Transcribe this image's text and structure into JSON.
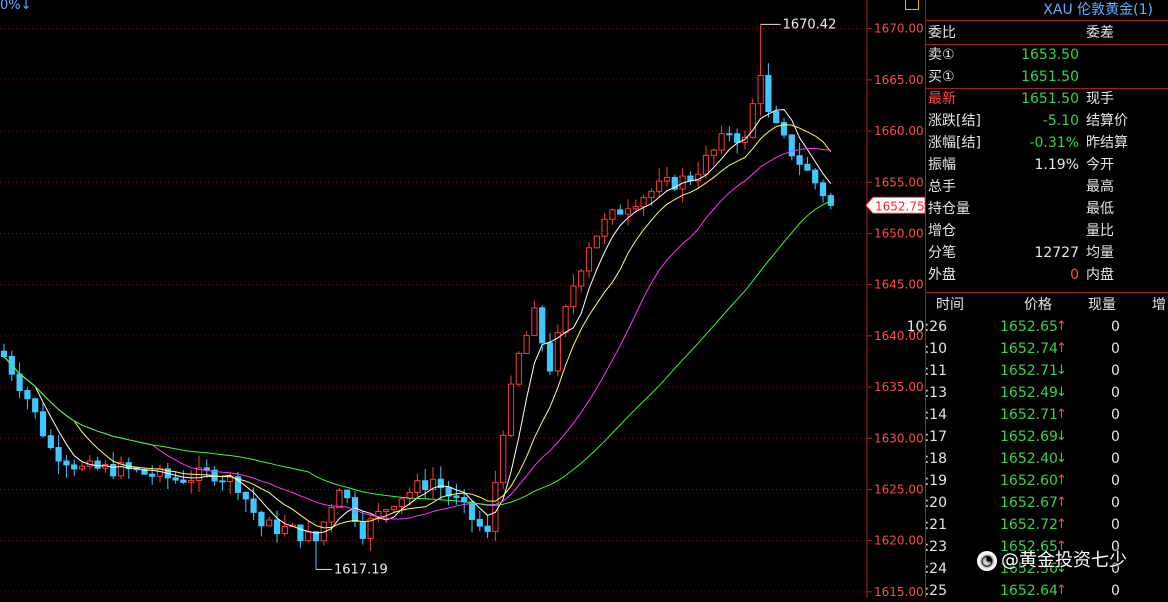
{
  "indicator_text": "0%↓",
  "panel": {
    "title": "XAU 伦敦黄金(1)",
    "quote_rows": [
      {
        "label": "委比",
        "value": "",
        "label2": "委差",
        "value_color": "red"
      },
      {
        "label": "卖①",
        "value": "1653.50",
        "label2": "",
        "value_color": "green"
      },
      {
        "label": "买①",
        "value": "1651.50",
        "label2": "",
        "value_color": "green"
      },
      {
        "label": "最新",
        "value": "1651.50",
        "label2": "现手",
        "value_color": "green"
      },
      {
        "label": "涨跌[结]",
        "value": "-5.10",
        "label2": "结算价",
        "value_color": "green"
      },
      {
        "label": "涨幅[结]",
        "value": "-0.31%",
        "label2": "昨结算",
        "value_color": "green"
      },
      {
        "label": "振幅",
        "value": "1.19%",
        "label2": "今开",
        "value_color": "white"
      },
      {
        "label": "总手",
        "value": "",
        "label2": "最高",
        "value_color": "white"
      },
      {
        "label": "持仓量",
        "value": "",
        "label2": "最低",
        "value_color": "white"
      },
      {
        "label": "增仓",
        "value": "",
        "label2": "量比",
        "value_color": "white"
      },
      {
        "label": "分笔",
        "value": "12727",
        "label2": "均量",
        "value_color": "white"
      },
      {
        "label": "外盘",
        "value": "0",
        "label2": "内盘",
        "value_color": "red"
      }
    ],
    "tick_headers": {
      "time": "时间",
      "price": "价格",
      "volume": "现量",
      "increase": "增"
    },
    "ticks": [
      {
        "time": "10:26",
        "price": "1652.65",
        "arrow": "↑",
        "dir": "up",
        "volume": "0"
      },
      {
        "time": ":10",
        "price": "1652.74",
        "arrow": "↑",
        "dir": "up",
        "volume": "0"
      },
      {
        "time": ":11",
        "price": "1652.71",
        "arrow": "↓",
        "dir": "down",
        "volume": "0"
      },
      {
        "time": ":13",
        "price": "1652.49",
        "arrow": "↓",
        "dir": "down",
        "volume": "0"
      },
      {
        "time": ":14",
        "price": "1652.71",
        "arrow": "↑",
        "dir": "up",
        "volume": "0"
      },
      {
        "time": ":17",
        "price": "1652.69",
        "arrow": "↓",
        "dir": "down",
        "volume": "0"
      },
      {
        "time": ":18",
        "price": "1652.40",
        "arrow": "↓",
        "dir": "down",
        "volume": "0"
      },
      {
        "time": ":19",
        "price": "1652.60",
        "arrow": "↑",
        "dir": "up",
        "volume": "0"
      },
      {
        "time": ":20",
        "price": "1652.67",
        "arrow": "↑",
        "dir": "up",
        "volume": "0"
      },
      {
        "time": ":21",
        "price": "1652.72",
        "arrow": "↑",
        "dir": "up",
        "volume": "0"
      },
      {
        "time": ":23",
        "price": "1652.65",
        "arrow": "↑",
        "dir": "up",
        "volume": "0"
      },
      {
        "time": ":24",
        "price": "1652.56",
        "arrow": "↓",
        "dir": "down",
        "volume": "0"
      },
      {
        "time": ":25",
        "price": "1652.64",
        "arrow": "↑",
        "dir": "up",
        "volume": "0"
      }
    ]
  },
  "watermark": {
    "icon": "weibo-icon",
    "text": "@黄金投资七少"
  },
  "colors": {
    "up": "#ff3b3b",
    "down": "#3fc8ff",
    "grid": "#7a1a1a",
    "axis_text": "#ff4a4a",
    "ma_short": "#ffffff",
    "ma_mid": "#ffff55",
    "ma_long": "#ff33ff",
    "ma_longest": "#33ff33"
  },
  "chart_data": {
    "type": "candlestick",
    "y_ticks": [
      "1670.00",
      "1665.00",
      "1660.00",
      "1655.00",
      "1650.00",
      "1645.00",
      "1640.00",
      "1635.00",
      "1630.00",
      "1625.00",
      "1620.00",
      "1615.00"
    ],
    "ylim": [
      1614.4,
      1672.8
    ],
    "current_price_label": "1652.75",
    "current_price": 1652.75,
    "high_annotation": {
      "text": "1670.42",
      "value": 1670.42
    },
    "low_annotation": {
      "text": "1617.19",
      "value": 1617.19
    },
    "key_points": [
      [
        0,
        1638.0
      ],
      [
        3,
        1634.0
      ],
      [
        6,
        1629.0
      ],
      [
        10,
        1627.0
      ],
      [
        15,
        1627.0
      ],
      [
        22,
        1626.0
      ],
      [
        27,
        1626.6
      ],
      [
        30,
        1625.5
      ],
      [
        33,
        1621.5
      ],
      [
        37,
        1621.0
      ],
      [
        40,
        1620.0
      ],
      [
        43,
        1625.5
      ],
      [
        46,
        1621.0
      ],
      [
        50,
        1624.0
      ],
      [
        55,
        1626.0
      ],
      [
        59,
        1623.0
      ],
      [
        62,
        1620.5
      ],
      [
        64,
        1631.0
      ],
      [
        66,
        1638.0
      ],
      [
        68,
        1642.0
      ],
      [
        70,
        1637.0
      ],
      [
        73,
        1645.0
      ],
      [
        75,
        1649.0
      ],
      [
        77,
        1651.0
      ],
      [
        80,
        1653.0
      ],
      [
        84,
        1654.5
      ],
      [
        88,
        1655.5
      ],
      [
        91,
        1658.0
      ],
      [
        93,
        1660.0
      ],
      [
        95,
        1659.0
      ],
      [
        97,
        1666.0
      ],
      [
        98,
        1661.5
      ],
      [
        100,
        1659.0
      ],
      [
        103,
        1656.0
      ],
      [
        106,
        1653.0
      ]
    ]
  }
}
